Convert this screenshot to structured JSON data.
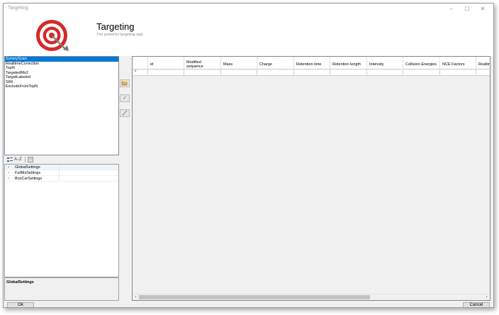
{
  "window": {
    "title": "Targeting",
    "controls": [
      "–",
      "☐",
      "✕"
    ]
  },
  "header": {
    "title": "Targeting",
    "subtitle": "The powerful targeting app."
  },
  "tree": {
    "items": [
      "SurveyScan",
      "RealtimeCorrection",
      "TopN",
      "TargetedMs2",
      "TargetLabeled",
      "SIM",
      "ExcludeFromTopN"
    ],
    "selected_index": 0
  },
  "property_grid": {
    "toolbar": {
      "categorized": "categorized-icon",
      "alphabetical": "A↓Z",
      "pages": "property-pages-icon"
    },
    "rows": [
      {
        "label": "GlobalSettings"
      },
      {
        "label": "FullMsSettings"
      },
      {
        "label": "BoxCarSettings"
      }
    ],
    "description_title": "GlobalSettings"
  },
  "side_buttons": {
    "add": "add-icon",
    "apply": "check-icon",
    "edit": "edit-icon"
  },
  "table": {
    "columns": [
      "id",
      "Modified sequence",
      "Mass",
      "Charge",
      "Retention time",
      "Retention length",
      "Intensity",
      "Collision Energies",
      "NCE Factors",
      "Realtime"
    ],
    "new_row_marker": "*"
  },
  "buttons": {
    "ok": "Ok",
    "cancel": "Cancel"
  },
  "colors": {
    "selection": "#0078d7",
    "logo_red": "#d42a2a"
  }
}
